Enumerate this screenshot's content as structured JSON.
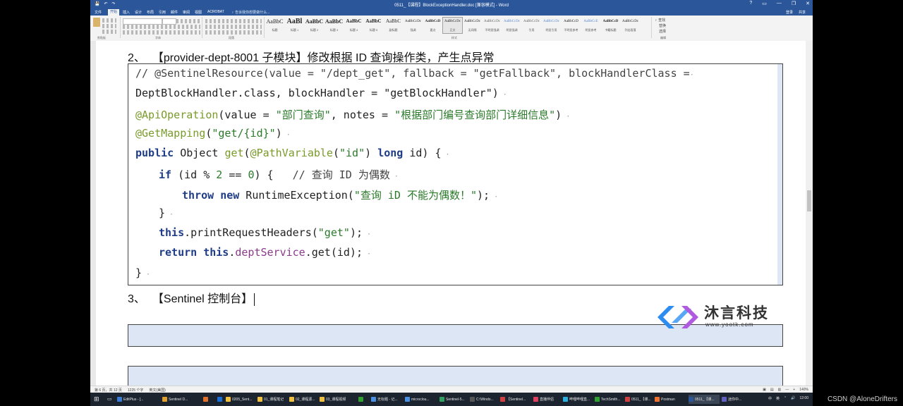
{
  "window": {
    "title": "0511_【课程】BlockExceptionHandler.doc [兼容模式] - Word",
    "qat": [
      "💾",
      "↶",
      "↷"
    ],
    "controls": [
      "?",
      "▭",
      "—",
      "❐",
      "✕"
    ]
  },
  "ribbon": {
    "tabs": [
      "文件",
      "开始",
      "插入",
      "设计",
      "布局",
      "引用",
      "邮件",
      "审阅",
      "视图",
      "ACROBAT"
    ],
    "active_tab": "开始",
    "tell_me": "♀ 告诉我你想要做什么...",
    "right": [
      "登录",
      "共享"
    ],
    "groups": [
      "剪贴板",
      "字体",
      "段落",
      "样式",
      "编辑"
    ],
    "styles": [
      {
        "preview": "AaBbC",
        "name": "标题"
      },
      {
        "preview": "AaBl",
        "name": "标题 1"
      },
      {
        "preview": "AaBbC",
        "name": "标题 2"
      },
      {
        "preview": "AaBbC",
        "name": "标题 3"
      },
      {
        "preview": "AaBbC",
        "name": "标题 4"
      },
      {
        "preview": "AaBbC",
        "name": "标题 5"
      },
      {
        "preview": "AaBbC",
        "name": "副标题"
      },
      {
        "preview": "AaBbCcDc",
        "name": "强调"
      },
      {
        "preview": "AaBbCcD",
        "name": "要点"
      },
      {
        "preview": "AaBbCcDc",
        "name": "正文"
      },
      {
        "preview": "AaBbCcDc",
        "name": "无间隔"
      },
      {
        "preview": "AaBbCcDc",
        "name": "不明显强调"
      },
      {
        "preview": "AaBbCcDc",
        "name": "明显强调"
      },
      {
        "preview": "AaBbCcDc",
        "name": "引用"
      },
      {
        "preview": "AaBbCcDc",
        "name": "明显引用"
      },
      {
        "preview": "AaBbCcD",
        "name": "不明显参考"
      },
      {
        "preview": "AaBbCcE",
        "name": "明显参考"
      },
      {
        "preview": "AaBbCcD",
        "name": "书籍标题"
      },
      {
        "preview": "AaBbCcDc",
        "name": "列出段落"
      }
    ],
    "selected_style": 9,
    "editing": [
      "♀ 查找",
      "替换",
      "选择"
    ]
  },
  "document": {
    "heading2": {
      "number": "2、",
      "text": "【provider-dept-8001 子模块】修改根据 ID 查询操作类，产生点异常"
    },
    "heading3": {
      "number": "3、",
      "text": "【Sentinel 控制台】"
    },
    "code": {
      "l1": "// @SentinelResource(value = \"/dept_get\", fallback = \"getFallback\", blockHandlerClass =",
      "l2": "DeptBlockHandler.class, blockHandler = \"getBlockHandler\")",
      "l3_ann": "@ApiOperation",
      "l3_a": "(value = ",
      "l3_s1": "\"部门查询\"",
      "l3_b": ", notes = ",
      "l3_s2": "\"根据部门编号查询部门详细信息\"",
      "l3_c": ")",
      "l4_ann": "@GetMapping",
      "l4_a": "(",
      "l4_s": "\"get/{id}\"",
      "l4_b": ")",
      "l5_kw1": "public",
      "l5_a": " Object ",
      "l5_fn": "get",
      "l5_b": "(",
      "l5_ann": "@PathVariable",
      "l5_c": "(",
      "l5_s": "\"id\"",
      "l5_d": ") ",
      "l5_kw2": "long",
      "l5_e": " id) {",
      "l6_kw": "if",
      "l6_a": " (id % ",
      "l6_n1": "2",
      "l6_b": " == ",
      "l6_n2": "0",
      "l6_c": ") {   ",
      "l6_cmt": "// 查询 ID 为偶数",
      "l7_kw1": "throw",
      "l7_sp": " ",
      "l7_kw2": "new",
      "l7_a": " RuntimeException(",
      "l7_s": "\"查询 iD 不能为偶数！\"",
      "l7_b": ");",
      "l8": "}",
      "l9_kw": "this",
      "l9_a": ".printRequestHeaders(",
      "l9_s": "\"get\"",
      "l9_b": ");",
      "l10_kw1": "return",
      "l10_sp": " ",
      "l10_kw2": "this",
      "l10_a": ".",
      "l10_fld": "deptService",
      "l10_b": ".get(id);",
      "l11": "}"
    }
  },
  "watermark": {
    "brand": "沐言科技",
    "url": "www.yootk.com",
    "colors": [
      "#2d8cf0",
      "#b05adf"
    ]
  },
  "statusbar": {
    "left": [
      "第 6 页，共 12 页",
      "1225 个字",
      "英文(美国)"
    ],
    "right": [
      "▣",
      "▤",
      "▥",
      "—",
      "+",
      "140%"
    ]
  },
  "taskbar": {
    "items": [
      {
        "label": "EditPlus - [...",
        "color": "#3a7bd5"
      },
      {
        "label": "Sentinel D...",
        "color": "#e0a030"
      },
      {
        "label": "",
        "color": "#e0702a"
      },
      {
        "label": "",
        "color": "#1a6fd6"
      },
      {
        "label": "0205_Sent...",
        "color": "#f0c040"
      },
      {
        "label": "01_课程笔记",
        "color": "#f0c040"
      },
      {
        "label": "02_课程源...",
        "color": "#f0c040"
      },
      {
        "label": "03_课程视频",
        "color": "#f0c040"
      },
      {
        "label": "",
        "color": "#30a030"
      },
      {
        "label": "无标题 - 记...",
        "color": "#4a90e2"
      },
      {
        "label": "microclou...",
        "color": "#4a90e2"
      },
      {
        "label": "Sentinel-5...",
        "color": "#30a060"
      },
      {
        "label": "C:\\Windo...",
        "color": "#555555"
      },
      {
        "label": "【Sentinel...",
        "color": "#d04040"
      },
      {
        "label": "直播伴侣",
        "color": "#e04060"
      },
      {
        "label": "哔哩哔哩直...",
        "color": "#2ab0e0"
      },
      {
        "label": "TechSmith...",
        "color": "#30a030"
      },
      {
        "label": "0511_【课...",
        "color": "#d04040"
      },
      {
        "label": "Postman",
        "color": "#f07030"
      },
      {
        "label": "0511_【课...",
        "color": "#2b579a"
      },
      {
        "label": "迷你中...",
        "color": "#6060c0"
      }
    ],
    "active_index": 19,
    "tray": [
      "中",
      "英",
      "⌃",
      "🔊",
      "12:00"
    ]
  },
  "credit": "CSDN @AloneDrifters"
}
